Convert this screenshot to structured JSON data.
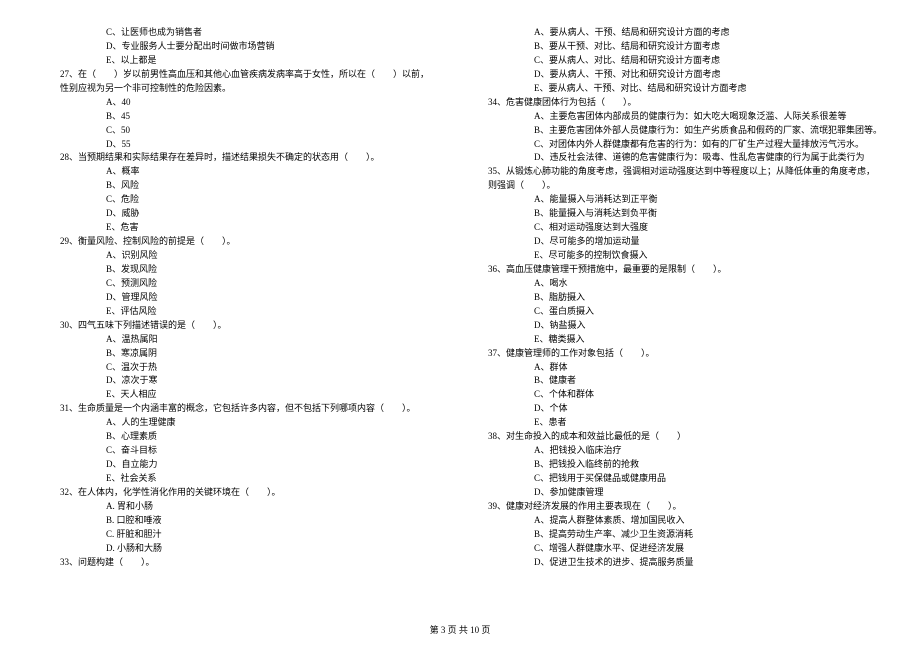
{
  "left": {
    "pre_q27": [
      "C、让医师也成为销售者",
      "D、专业服务人士要分配出时间做市场营销",
      "E、以上都是"
    ],
    "q27_stem_a": "27、在（　　）岁以前男性高血压和其他心血管疾病发病率高于女性，所以在（　　）以前，",
    "q27_stem_b": "性别应视为另一个非可控制性的危险因素。",
    "q27_opts": [
      "A、40",
      "B、45",
      "C、50",
      "D、55"
    ],
    "q28_stem": "28、当预期结果和实际结果存在差异时，描述结果损失不确定的状态用（　　）。",
    "q28_opts": [
      "A、概率",
      "B、风险",
      "C、危险",
      "D、威胁",
      "E、危害"
    ],
    "q29_stem": "29、衡量风险、控制风险的前提是（　　）。",
    "q29_opts": [
      "A、识别风险",
      "B、发现风险",
      "C、预测风险",
      "D、管理风险",
      "E、评估风险"
    ],
    "q30_stem": "30、四气五味下列描述错误的是（　　）。",
    "q30_opts": [
      "A、温热属阳",
      "B、寒凉属阴",
      "C、温次于热",
      "D、凉次于寒",
      "E、天人相应"
    ],
    "q31_stem": "31、生命质量是一个内涵丰富的概念，它包括许多内容，但不包括下列哪项内容（　　）。",
    "q31_opts": [
      "A、人的生理健康",
      "B、心理素质",
      "C、奋斗目标",
      "D、自立能力",
      "E、社会关系"
    ],
    "q32_stem": "32、在人体内，化学性消化作用的关键环境在（　　）。",
    "q32_opts": [
      "A. 胃和小肠",
      "B. 口腔和唾液",
      "C. 肝脏和胆汁",
      "D. 小肠和大肠"
    ],
    "q33_stem": "33、问题构建（　　）。"
  },
  "right": {
    "pre_q34": [
      "A、要从病人、干预、结局和研究设计方面的考虑",
      "B、要从干预、对比、结局和研究设计方面考虑",
      "C、要从病人、对比、结局和研究设计方面考虑",
      "D、要从病人、干预、对比和研究设计方面考虑",
      "E、要从病人、干预、对比、结局和研究设计方面考虑"
    ],
    "q34_stem": "34、危害健康团体行为包括（　　）。",
    "q34_opts": [
      "A、主要危害团体内部成员的健康行为：如大吃大喝现象泛滥、人际关系很差等",
      "B、主要危害团体外部人员健康行为：如生产劣质食品和假药的厂家、流氓犯罪集团等。",
      "C、对团体内外人群健康都有危害的行为：如有的厂矿生产过程大量排放污气污水。",
      "D、违反社会法律、道德的危害健康行为：吸毒、性乱危害健康的行为属于此类行为"
    ],
    "q35_stem_a": "35、从锻炼心肺功能的角度考虑，强调相对运动强度达到中等程度以上；从降低体重的角度考虑，",
    "q35_stem_b": "则强调（　　）。",
    "q35_opts": [
      "A、能量摄入与消耗达到正平衡",
      "B、能量摄入与消耗达到负平衡",
      "C、相对运动强度达到大强度",
      "D、尽可能多的增加运动量",
      "E、尽可能多的控制饮食摄入"
    ],
    "q36_stem": "36、高血压健康管理干预措施中，最重要的是限制（　　）。",
    "q36_opts": [
      "A、喝水",
      "B、脂肪摄入",
      "C、蛋白质摄入",
      "D、钠盐摄入",
      "E、糖类摄入"
    ],
    "q37_stem": "37、健康管理师的工作对象包括（　　）。",
    "q37_opts": [
      "A、群体",
      "B、健康者",
      "C、个体和群体",
      "D、个体",
      "E、患者"
    ],
    "q38_stem": "38、对生命投入的成本和效益比最低的是（　　）",
    "q38_opts": [
      "A、把钱投入临床治疗",
      "B、把钱投入临终前的抢救",
      "C、把钱用于买保健品或健康用品",
      "D、参加健康管理"
    ],
    "q39_stem": "39、健康对经济发展的作用主要表现在（　　）。",
    "q39_opts": [
      "A、提高人群整体素质、增加国民收入",
      "B、提高劳动生产率、减少卫生资源消耗",
      "C、增强人群健康水平、促进经济发展",
      "D、促进卫生技术的进步、提高服务质量"
    ]
  },
  "footer": "第 3 页 共 10 页"
}
